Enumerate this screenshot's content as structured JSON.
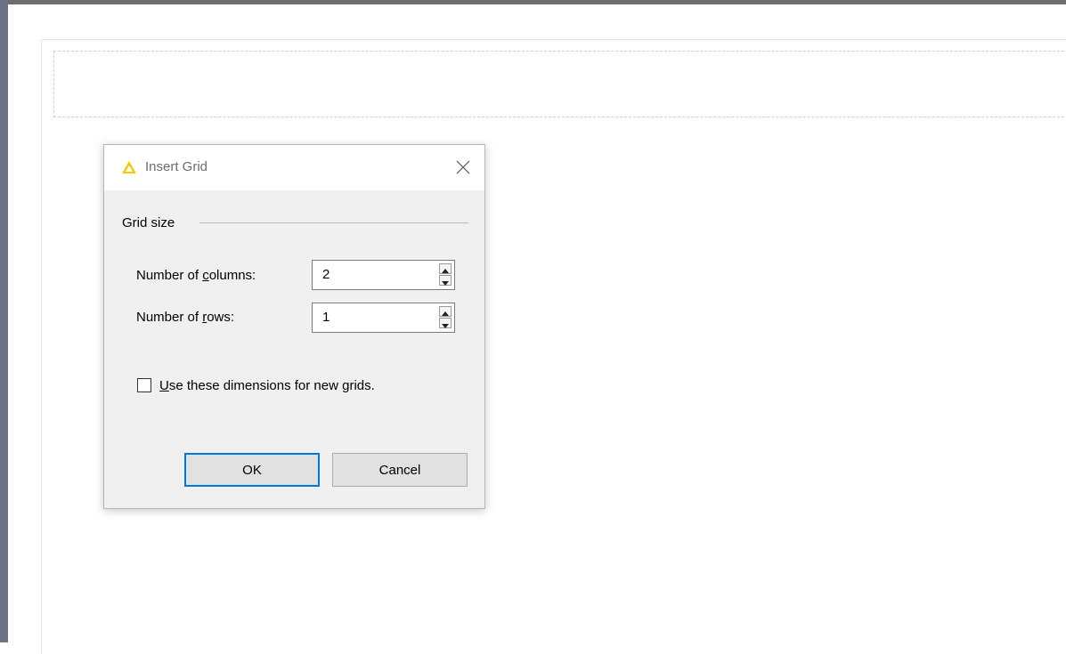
{
  "dialog": {
    "title": "Insert Grid",
    "app_icon": "warning-triangle-icon",
    "close_icon": "close-icon",
    "group_label": "Grid size",
    "columns": {
      "label_prefix": "Number of ",
      "label_accel": "c",
      "label_suffix": "olumns:",
      "value": "2"
    },
    "rows": {
      "label_prefix": "Number of ",
      "label_accel": "r",
      "label_suffix": "ows:",
      "value": "1"
    },
    "remember": {
      "label_accel": "U",
      "label_suffix": "se these dimensions for new grids.",
      "checked": false
    },
    "ok_label": "OK",
    "cancel_label": "Cancel"
  },
  "colors": {
    "accent": "#0078d7",
    "icon_yellow": "#f2c811",
    "dialog_bg": "#f0f0f0"
  }
}
